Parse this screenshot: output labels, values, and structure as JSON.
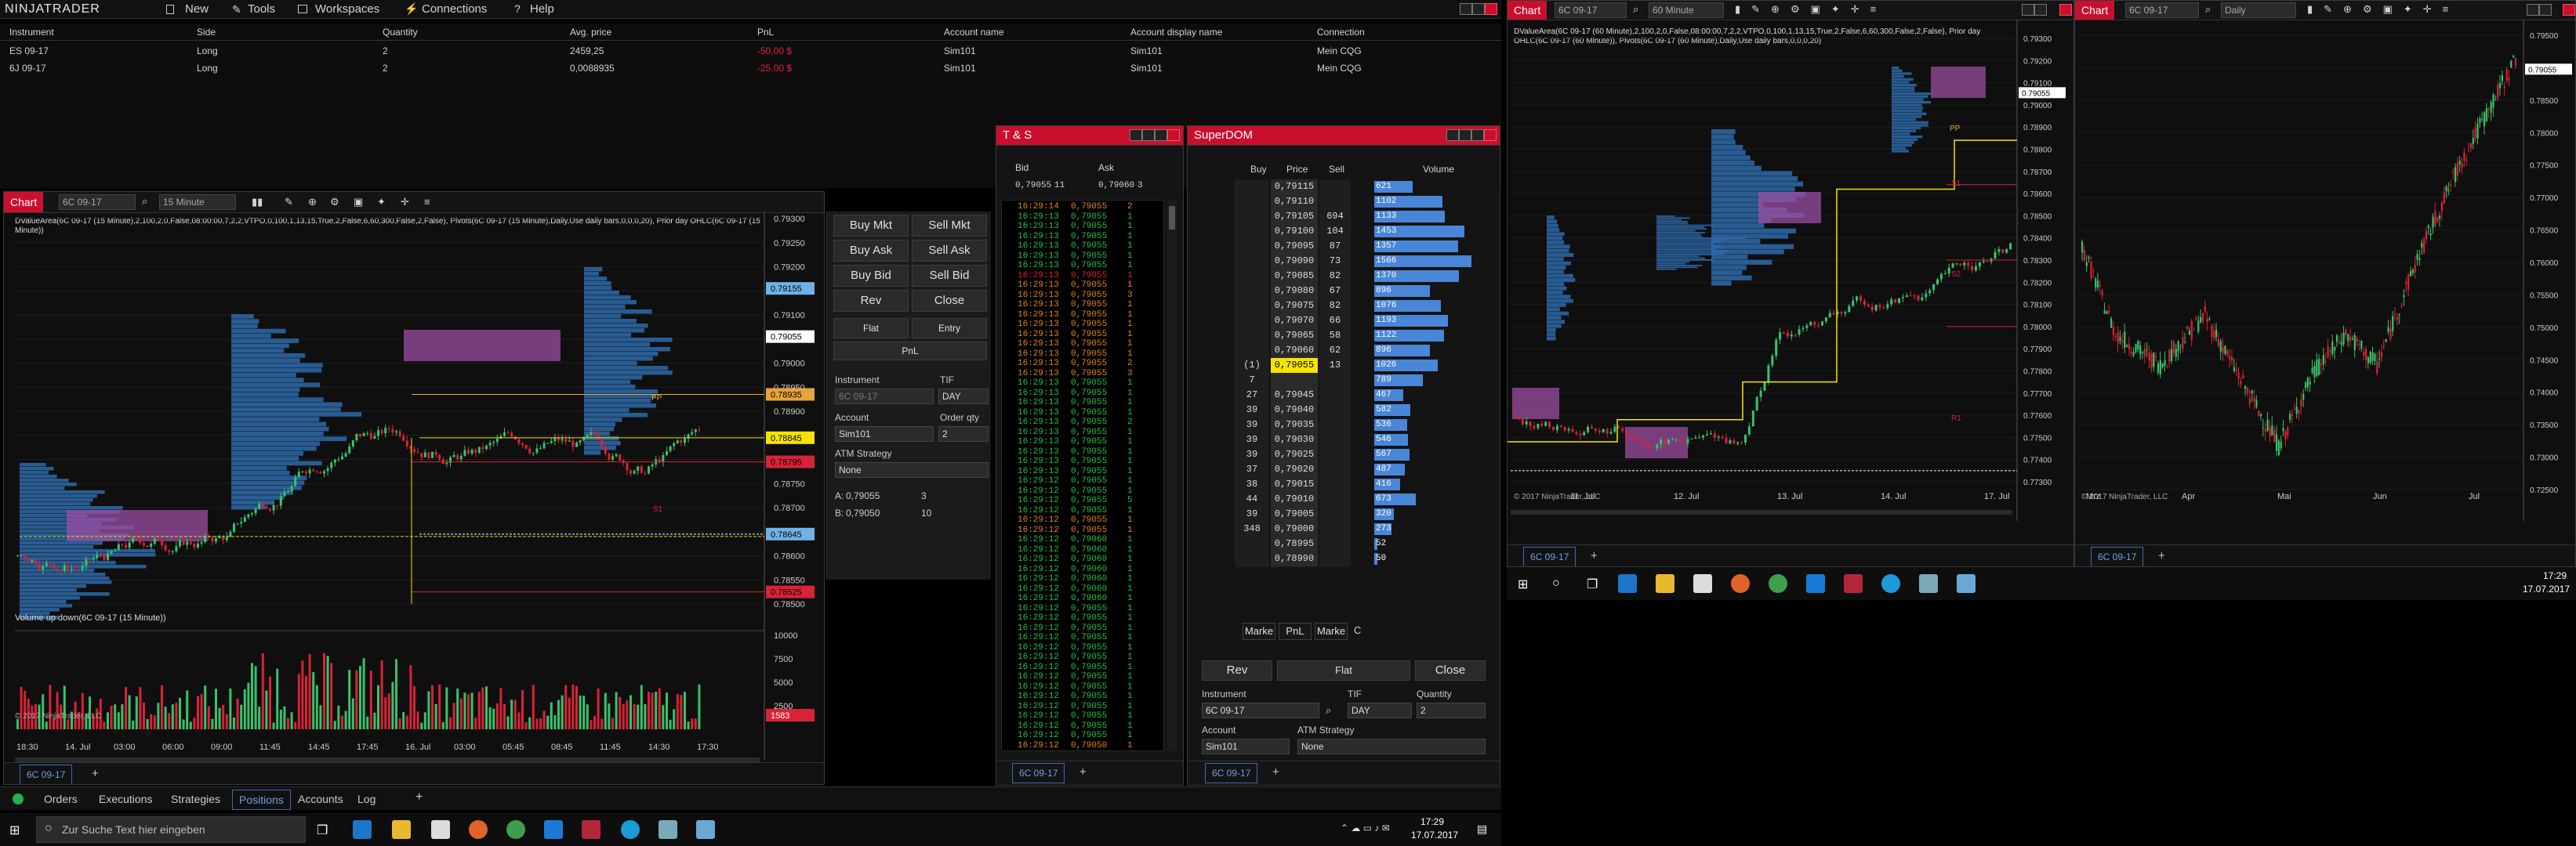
{
  "menu": {
    "logo": "NINJATRADER",
    "items": [
      "New",
      "Tools",
      "Workspaces",
      "Connections",
      "Help"
    ]
  },
  "positions": {
    "headers": [
      "Instrument",
      "Side",
      "Quantity",
      "Avg. price",
      "PnL",
      "Account name",
      "Account display name",
      "Connection"
    ],
    "rows": [
      [
        "ES 09-17",
        "Long",
        "2",
        "2459,25",
        "-50,00 $",
        "Sim101",
        "Sim101",
        "Mein CQG"
      ],
      [
        "6J 09-17",
        "Long",
        "2",
        "0,0088935",
        "-25,00 $",
        "Sim101",
        "Sim101",
        "Mein CQG"
      ]
    ]
  },
  "chart_left": {
    "tab": "Chart",
    "instrument": "6C 09-17",
    "interval": "15 Minute",
    "indicator_text": "DValueArea(6C 09-17 (15 Minute),2,100,2,0,False,08:00:00,7,2,2,VTPO,0,100,1,13,15,True,2,False,6,60,300,False,2,False), Pivots(6C 09-17 (15 Minute),Daily,Use daily bars,0,0,0,20), Prior day OHLC(6C 09-17 (15 Minute))",
    "volume_title": "Volume up down(6C 09-17 (15 Minute))",
    "copyright": "© 2017 NinjaTrader, LLC",
    "price_axis": [
      "0.79300",
      "0.79250",
      "0.79200",
      "0.79150",
      "0.79100",
      "0.79050",
      "0.79000",
      "0.78950",
      "0.78900",
      "0.78850",
      "0.78800",
      "0.78750",
      "0.78700",
      "0.78650",
      "0.78600",
      "0.78550",
      "0.78500"
    ],
    "price_tags": [
      {
        "text": "0.79155",
        "color": "#6fb3e6"
      },
      {
        "text": "0.79055",
        "color": "#ffffff"
      },
      {
        "text": "0.78935",
        "color": "#e8a33c"
      },
      {
        "text": "0.78845",
        "color": "#f5e400"
      },
      {
        "text": "0.78795",
        "color": "#d92236"
      },
      {
        "text": "0.78645",
        "color": "#6fb3e6"
      },
      {
        "text": "0.78525",
        "color": "#d92236"
      }
    ],
    "vol_axis": [
      "10000",
      "7500",
      "5000",
      "2500",
      "1583"
    ],
    "time_axis": [
      "18:30",
      "14. Jul",
      "03:00",
      "06:00",
      "09:00",
      "11:45",
      "14:45",
      "17:45",
      "16. Jul",
      "03:00",
      "05:45",
      "08:45",
      "11:45",
      "14:30",
      "17:30"
    ],
    "labels": {
      "pp": "PP",
      "s1": "S1"
    },
    "footer_tab": "6C 09-17"
  },
  "order_entry": {
    "buttons": [
      "Buy Mkt",
      "Sell Mkt",
      "Buy Ask",
      "Sell Ask",
      "Buy Bid",
      "Sell Bid",
      "Rev",
      "Close"
    ],
    "flat": "Flat",
    "entry": "Entry",
    "pnl": "PnL",
    "instrument_label": "Instrument",
    "instrument_value": "6C 09-17",
    "tif_label": "TIF",
    "tif_value": "DAY",
    "account_label": "Account",
    "account_value": "Sim101",
    "qty_label": "Order qty",
    "qty_value": "2",
    "atm_label": "ATM Strategy",
    "atm_value": "None",
    "a_label": "A:",
    "a_price": "0,79055",
    "a_size": "3",
    "b_label": "B:",
    "b_price": "0,79050",
    "b_size": "10"
  },
  "ts": {
    "title": "T & S",
    "bid_label": "Bid",
    "ask_label": "Ask",
    "bid": "0,79055",
    "bid_size": "11",
    "ask": "0,79060",
    "ask_size": "3",
    "rows": [
      [
        "16:29:14",
        "0,79055",
        "2",
        "o"
      ],
      [
        "16:29:13",
        "0,79055",
        "1",
        "g"
      ],
      [
        "16:29:13",
        "0,79055",
        "1",
        "g"
      ],
      [
        "16:29:13",
        "0,79055",
        "1",
        "g"
      ],
      [
        "16:29:13",
        "0,79055",
        "1",
        "g"
      ],
      [
        "16:29:13",
        "0,79055",
        "1",
        "g"
      ],
      [
        "16:29:13",
        "0,79055",
        "1",
        "g"
      ],
      [
        "16:29:13",
        "0,79055",
        "1",
        "r"
      ],
      [
        "16:29:13",
        "0,79055",
        "1",
        "o"
      ],
      [
        "16:29:13",
        "0,79055",
        "3",
        "o"
      ],
      [
        "16:29:13",
        "0,79055",
        "1",
        "o"
      ],
      [
        "16:29:13",
        "0,79055",
        "1",
        "o"
      ],
      [
        "16:29:13",
        "0,79055",
        "1",
        "o"
      ],
      [
        "16:29:13",
        "0,79055",
        "1",
        "o"
      ],
      [
        "16:29:13",
        "0,79055",
        "1",
        "o"
      ],
      [
        "16:29:13",
        "0,79055",
        "1",
        "o"
      ],
      [
        "16:29:13",
        "0,79055",
        "2",
        "o"
      ],
      [
        "16:29:13",
        "0,79055",
        "3",
        "o"
      ],
      [
        "16:29:13",
        "0,79055",
        "1",
        "g"
      ],
      [
        "16:29:13",
        "0,79055",
        "1",
        "g"
      ],
      [
        "16:29:13",
        "0,79055",
        "1",
        "g"
      ],
      [
        "16:29:13",
        "0,79055",
        "1",
        "g"
      ],
      [
        "16:29:13",
        "0,79055",
        "2",
        "g"
      ],
      [
        "16:29:13",
        "0,79055",
        "1",
        "g"
      ],
      [
        "16:29:13",
        "0,79055",
        "1",
        "g"
      ],
      [
        "16:29:13",
        "0,79055",
        "1",
        "g"
      ],
      [
        "16:29:13",
        "0,79055",
        "1",
        "g"
      ],
      [
        "16:29:13",
        "0,79055",
        "1",
        "g"
      ],
      [
        "16:29:12",
        "0,79055",
        "1",
        "g"
      ],
      [
        "16:29:12",
        "0,79055",
        "1",
        "g"
      ],
      [
        "16:29:12",
        "0,79055",
        "5",
        "g"
      ],
      [
        "16:29:12",
        "0,79055",
        "1",
        "g"
      ],
      [
        "16:29:12",
        "0,79055",
        "1",
        "o"
      ],
      [
        "16:29:12",
        "0,79055",
        "1",
        "o"
      ],
      [
        "16:29:12",
        "0,79060",
        "1",
        "g"
      ],
      [
        "16:29:12",
        "0,79060",
        "1",
        "g"
      ],
      [
        "16:29:12",
        "0,79060",
        "1",
        "g"
      ],
      [
        "16:29:12",
        "0,79060",
        "1",
        "g"
      ],
      [
        "16:29:12",
        "0,79060",
        "1",
        "g"
      ],
      [
        "16:29:12",
        "0,79060",
        "1",
        "g"
      ],
      [
        "16:29:12",
        "0,79060",
        "1",
        "g"
      ],
      [
        "16:29:12",
        "0,79055",
        "1",
        "g"
      ],
      [
        "16:29:12",
        "0,79055",
        "1",
        "g"
      ],
      [
        "16:29:12",
        "0,79055",
        "1",
        "g"
      ],
      [
        "16:29:12",
        "0,79055",
        "1",
        "g"
      ],
      [
        "16:29:12",
        "0,79055",
        "1",
        "g"
      ],
      [
        "16:29:12",
        "0,79055",
        "1",
        "g"
      ],
      [
        "16:29:12",
        "0,79055",
        "1",
        "g"
      ],
      [
        "16:29:12",
        "0,79055",
        "1",
        "g"
      ],
      [
        "16:29:12",
        "0,79055",
        "1",
        "g"
      ],
      [
        "16:29:12",
        "0,79055",
        "1",
        "g"
      ],
      [
        "16:29:12",
        "0,79055",
        "1",
        "g"
      ],
      [
        "16:29:12",
        "0,79055",
        "1",
        "g"
      ],
      [
        "16:29:12",
        "0,79055",
        "1",
        "g"
      ],
      [
        "16:29:12",
        "0,79055",
        "1",
        "g"
      ],
      [
        "16:29:12",
        "0,79050",
        "1",
        "o"
      ]
    ],
    "footer_tab": "6C 09-17"
  },
  "superdom": {
    "title": "SuperDOM",
    "headers": [
      "Buy",
      "Price",
      "Sell",
      "Volume"
    ],
    "rows": [
      {
        "buy": "",
        "price": "0,79115",
        "sell": "",
        "vol": "621"
      },
      {
        "buy": "",
        "price": "0,79110",
        "sell": "",
        "vol": "1102"
      },
      {
        "buy": "",
        "price": "0,79105",
        "sell": "694",
        "vol": "1133"
      },
      {
        "buy": "",
        "price": "0,79100",
        "sell": "104",
        "vol": "1453"
      },
      {
        "buy": "",
        "price": "0,79095",
        "sell": "87",
        "vol": "1357"
      },
      {
        "buy": "",
        "price": "0,79090",
        "sell": "73",
        "vol": "1566"
      },
      {
        "buy": "",
        "price": "0,79085",
        "sell": "82",
        "vol": "1370"
      },
      {
        "buy": "",
        "price": "0,79080",
        "sell": "67",
        "vol": "896"
      },
      {
        "buy": "",
        "price": "0,79075",
        "sell": "82",
        "vol": "1076"
      },
      {
        "buy": "",
        "price": "0,79070",
        "sell": "66",
        "vol": "1193"
      },
      {
        "buy": "",
        "price": "0,79065",
        "sell": "58",
        "vol": "1122"
      },
      {
        "buy": "",
        "price": "0,79060",
        "sell": "62",
        "vol": "896"
      },
      {
        "buy": "(1)",
        "price": "0,79055",
        "sell": "13",
        "vol": "1026"
      },
      {
        "buy": "7",
        "price": "",
        "sell": "",
        "vol": "789"
      },
      {
        "buy": "27",
        "price": "0,79045",
        "sell": "",
        "vol": "467"
      },
      {
        "buy": "39",
        "price": "0,79040",
        "sell": "",
        "vol": "582"
      },
      {
        "buy": "39",
        "price": "0,79035",
        "sell": "",
        "vol": "536"
      },
      {
        "buy": "39",
        "price": "0,79030",
        "sell": "",
        "vol": "546"
      },
      {
        "buy": "39",
        "price": "0,79025",
        "sell": "",
        "vol": "567"
      },
      {
        "buy": "37",
        "price": "0,79020",
        "sell": "",
        "vol": "487"
      },
      {
        "buy": "38",
        "price": "0,79015",
        "sell": "",
        "vol": "416"
      },
      {
        "buy": "44",
        "price": "0,79010",
        "sell": "",
        "vol": "673"
      },
      {
        "buy": "39",
        "price": "0,79005",
        "sell": "",
        "vol": "320"
      },
      {
        "buy": "348",
        "price": "0,79000",
        "sell": "",
        "vol": "273"
      },
      {
        "buy": "",
        "price": "0,78995",
        "sell": "",
        "vol": "52"
      },
      {
        "buy": "",
        "price": "0,78990",
        "sell": "",
        "vol": "50"
      }
    ],
    "bottom_left": "Marke",
    "bottom_pnl": "PnL",
    "bottom_right": "Marke",
    "bottom_c": "C",
    "rev": "Rev",
    "flat": "Flat",
    "close": "Close",
    "instrument_label": "Instrument",
    "instrument_value": "6C 09-17",
    "tif_label": "TIF",
    "tif_value": "DAY",
    "qty_label": "Quantity",
    "qty_value": "2",
    "account_label": "Account",
    "account_value": "Sim101",
    "atm_label": "ATM Strategy",
    "atm_value": "None",
    "footer_tab": "6C 09-17"
  },
  "chart_mid": {
    "tab": "Chart",
    "instrument": "6C 09-17",
    "interval": "60 Minute",
    "indicator_text": "DValueArea(6C 09-17 (60 Minute),2,100,2,0,False,08:00:00,7,2,2,VTPO,0,100,1,13,15,True,2,False,6,60,300,False,2,False), Prior day OHLC(6C 09-17 (60 Minute)), Pivots(6C 09-17 (60 Minute),Daily,Use daily bars,0,0,0,20)",
    "price_axis": [
      "0.79300",
      "0.79200",
      "0.79100",
      "0.79000",
      "0.78900",
      "0.78800",
      "0.78700",
      "0.78600",
      "0.78500",
      "0.78400",
      "0.78300",
      "0.78200",
      "0.78100",
      "0.78000",
      "0.77900",
      "0.77800",
      "0.77700",
      "0.77600",
      "0.77500",
      "0.77400",
      "0.77300"
    ],
    "tag": "0.79055",
    "time_axis": [
      "11. Jul",
      "12. Jul",
      "13. Jul",
      "14. Jul",
      "17. Jul"
    ],
    "copyright": "© 2017 NinjaTrader, LLC",
    "labels": {
      "pp": "PP",
      "r1": "R1",
      "s1": "S1",
      "s2": "S2"
    },
    "footer_tab": "6C 09-17"
  },
  "chart_right": {
    "tab": "Chart",
    "instrument": "6C 09-17",
    "interval": "Daily",
    "price_axis": [
      "0.79500",
      "0.79000",
      "0.78500",
      "0.78000",
      "0.77500",
      "0.77000",
      "0.76500",
      "0.76000",
      "0.75500",
      "0.75000",
      "0.74500",
      "0.74000",
      "0.73500",
      "0.73000",
      "0.72500"
    ],
    "tag": "0.79055",
    "time_axis": [
      "Mrz",
      "Apr",
      "Mai",
      "Jun",
      "Jul"
    ],
    "copyright": "© 2017 NinjaTrader, LLC",
    "footer_tab": "6C 09-17"
  },
  "bottom_tabs": [
    "Orders",
    "Executions",
    "Strategies",
    "Positions",
    "Accounts",
    "Log"
  ],
  "taskbar": {
    "search_placeholder": "Zur Suche Text hier eingeben",
    "time": "17:29",
    "date": "17.07.2017"
  },
  "taskbar2": {
    "time": "17:29",
    "date": "17.07.2017"
  },
  "colors": {
    "accent": "#c8102e",
    "buy": "#1c9c3a",
    "sell": "#d92236",
    "dom_bar": "#4a86d8",
    "profile": "#2e6fb3",
    "vtpo": "#9b4ea3"
  }
}
